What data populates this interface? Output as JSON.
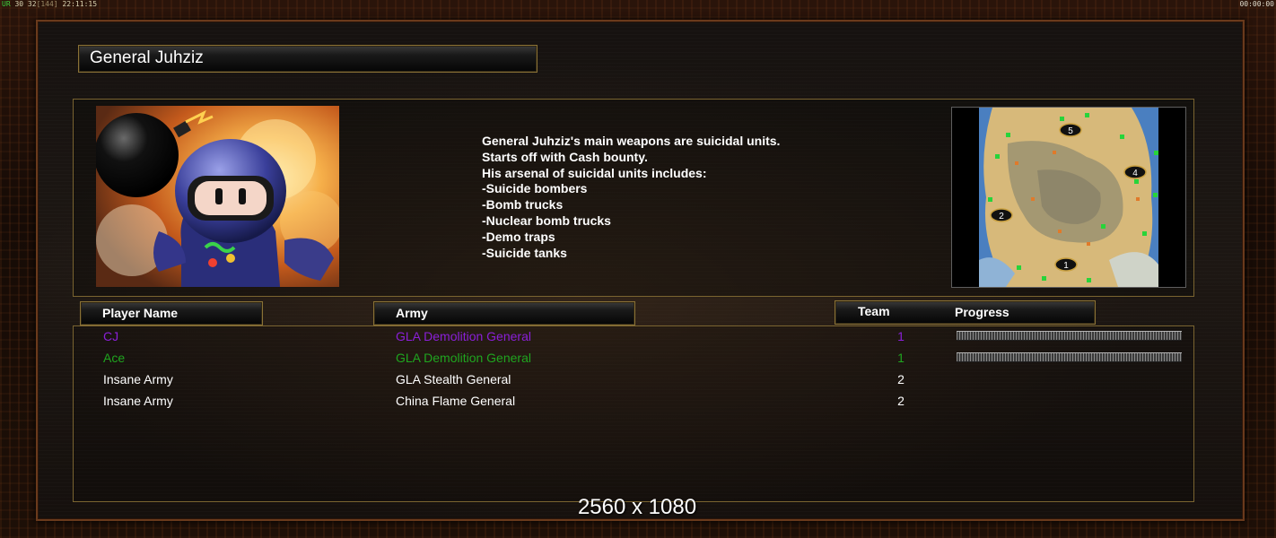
{
  "status": {
    "left_prefix": "UR",
    "left_values": "30 32",
    "left_bracket": "[144]",
    "left_clock": "22:11:15",
    "right_clock": "00:00:00"
  },
  "general": {
    "title": "General Juhziz",
    "description": [
      "General Juhziz's main weapons are suicidal units.",
      "Starts off with Cash bounty.",
      "His arsenal of suicidal units includes:",
      "-Suicide bombers",
      "-Bomb trucks",
      "-Nuclear bomb trucks",
      "-Demo traps",
      "-Suicide tanks"
    ]
  },
  "minimap": {
    "start_positions": [
      "5",
      "4",
      "2",
      "1"
    ]
  },
  "columns": {
    "player_name": "Player Name",
    "army": "Army",
    "team": "Team",
    "progress": "Progress"
  },
  "players": [
    {
      "name": "CJ",
      "army": "GLA Demolition General",
      "team": "1",
      "color": "#8a1fd8",
      "progress": 1.0
    },
    {
      "name": "Ace",
      "army": "GLA Demolition General",
      "team": "1",
      "color": "#1fa51f",
      "progress": 1.0
    },
    {
      "name": "Insane Army",
      "army": "GLA Stealth General",
      "team": "2",
      "color": "#ffffff",
      "progress": null
    },
    {
      "name": "Insane Army",
      "army": "China Flame General",
      "team": "2",
      "color": "#ffffff",
      "progress": null
    }
  ],
  "resolution_overlay": "2560 x 1080"
}
